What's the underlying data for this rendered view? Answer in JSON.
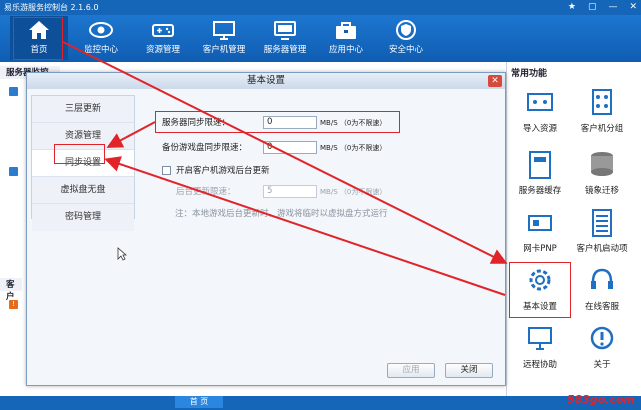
{
  "window": {
    "title": "易乐游服务控制台 2.1.6.0",
    "controls": [
      "★",
      "▢",
      "—",
      "✕"
    ]
  },
  "toolbar": {
    "items": [
      {
        "label": "首页",
        "icon": "home-icon"
      },
      {
        "label": "监控中心",
        "icon": "eye-icon"
      },
      {
        "label": "资源管理",
        "icon": "gamepad-icon"
      },
      {
        "label": "客户机管理",
        "icon": "monitor-icon"
      },
      {
        "label": "服务器管理",
        "icon": "server-icon"
      },
      {
        "label": "应用中心",
        "icon": "toolbox-icon"
      },
      {
        "label": "安全中心",
        "icon": "shield-icon"
      }
    ]
  },
  "left_panel": {
    "section1": "服务器监控",
    "section2": "客户"
  },
  "right_panel": {
    "title": "常用功能",
    "items": [
      {
        "label": "导入资源",
        "icon": "import-icon"
      },
      {
        "label": "客户机分组",
        "icon": "group-icon"
      },
      {
        "label": "服务器缓存",
        "icon": "cache-icon"
      },
      {
        "label": "镜象迁移",
        "icon": "disk-icon"
      },
      {
        "label": "网卡PNP",
        "icon": "nic-icon"
      },
      {
        "label": "客户机启动项",
        "icon": "startup-icon"
      },
      {
        "label": "基本设置",
        "icon": "gear-icon"
      },
      {
        "label": "在线客服",
        "icon": "headset-icon"
      },
      {
        "label": "远程协助",
        "icon": "remote-icon"
      },
      {
        "label": "关于",
        "icon": "info-icon"
      }
    ]
  },
  "bottom": {
    "tab": "首 页"
  },
  "dialog": {
    "title": "基本设置",
    "close": "✕",
    "nav": [
      {
        "label": "三层更新"
      },
      {
        "label": "资源管理"
      },
      {
        "label": "同步设置"
      },
      {
        "label": "虚拟盘无盘"
      },
      {
        "label": "密码管理"
      }
    ],
    "server_sync_label": "服务器同步限速：",
    "server_sync_value": "0",
    "backup_sync_label": "备份游戏盘同步限速：",
    "backup_sync_value": "0",
    "unit": "MB/S  （0为不限速）",
    "checkbox_label": "开启客户机游戏后台更新",
    "bg_update_label": "后台更新限速：",
    "bg_update_value": "5",
    "note": "注：本地游戏后台更新时，游戏将临时以虚拟盘方式运行",
    "apply": "应用",
    "close_btn": "关闭"
  },
  "watermark": "583go.com",
  "colors": {
    "titlebar": "#1565b8",
    "highlight": "#e0242a"
  }
}
